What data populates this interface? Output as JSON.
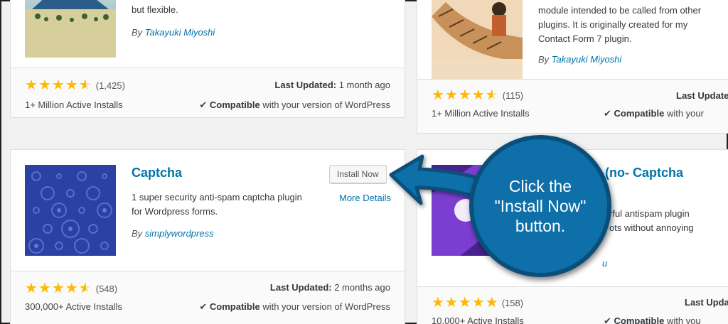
{
  "cards": {
    "top_left": {
      "desc_tail": "but flexible.",
      "by_prefix": "By",
      "author": "Takayuki Miyoshi",
      "rating_count": "(1,425)",
      "last_updated_label": "Last Updated:",
      "last_updated_value": "1 month ago",
      "installs": "1+ Million Active Installs",
      "compat_strong": "Compatible",
      "compat_rest": "with your version of WordPress"
    },
    "top_right": {
      "desc_line1": "module intended to be called from other",
      "desc_line2": "plugins. It is originally created for my",
      "desc_line3": "Contact Form 7 plugin.",
      "by_prefix": "By",
      "author": "Takayuki Miyoshi",
      "rating_count": "(115)",
      "last_updated_label": "Last Update",
      "installs": "1+ Million Active Installs",
      "compat_strong": "Compatible",
      "compat_rest": "with your"
    },
    "bottom_left": {
      "title": "Captcha",
      "install_label": "Install Now",
      "more_details": "More Details",
      "desc_line1": "1 super security anti-spam captcha plugin",
      "desc_line2": "for Wordpress forms.",
      "by_prefix": "By",
      "author": "simplywordpress",
      "rating_count": "(548)",
      "last_updated_label": "Last Updated:",
      "last_updated_value": "2 months ago",
      "installs": "300,000+ Active Installs",
      "compat_strong": "Compatible",
      "compat_rest": "with your version of WordPress"
    },
    "bottom_right": {
      "title": "(no- Captcha",
      "desc_line1": "rful antispam plugin",
      "desc_line2": "ots without annoying",
      "author_tail": "u",
      "rating_count": "(158)",
      "last_updated_label": "Last Upda",
      "installs": "10,000+ Active Installs",
      "compat_strong": "Compatible",
      "compat_rest": "with you"
    }
  },
  "callout": {
    "line1": "Click the",
    "line2": "\"Install Now\"",
    "line3": "button."
  },
  "colors": {
    "link": "#0073aa",
    "star": "#ffb900",
    "callout": "#0f6fa8",
    "callout_border": "#0a4f7a"
  },
  "icons": {
    "star": "★",
    "check": "✔"
  },
  "ratings": {
    "top_left": 4.5,
    "top_right": 4.5,
    "bottom_left": 4.5,
    "bottom_right": 5
  }
}
